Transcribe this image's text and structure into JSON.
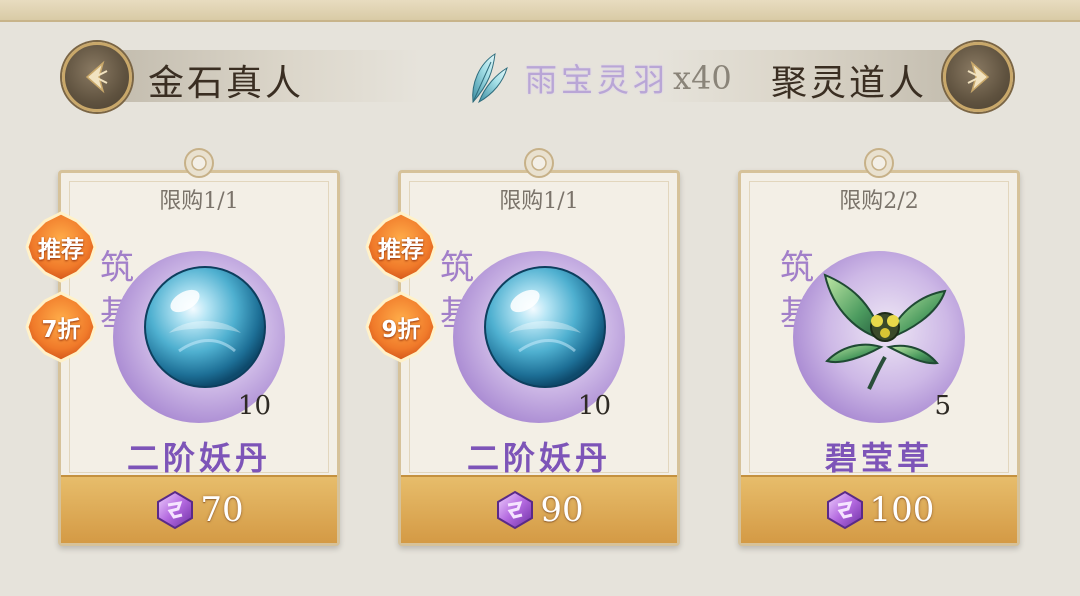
{
  "nav": {
    "left_label": "金石真人",
    "right_label": "聚灵道人",
    "currency_name": "雨宝灵羽",
    "currency_count": "x40"
  },
  "cards": [
    {
      "limit": "限购1/1",
      "grade_1": "筑",
      "grade_2": "基",
      "quantity": "10",
      "name": "二阶妖丹",
      "price": "70",
      "recommend": "推荐",
      "discount": "7折",
      "item_icon": "blue-orb-icon"
    },
    {
      "limit": "限购1/1",
      "grade_1": "筑",
      "grade_2": "基",
      "quantity": "10",
      "name": "二阶妖丹",
      "price": "90",
      "recommend": "推荐",
      "discount": "9折",
      "item_icon": "blue-orb-icon"
    },
    {
      "limit": "限购2/2",
      "grade_1": "筑",
      "grade_2": "基",
      "quantity": "5",
      "name": "碧莹草",
      "price": "100",
      "item_icon": "green-leaf-herb-icon"
    }
  ],
  "colors": {
    "name_purple": "#7d54b8",
    "grade_purple": "#a27fc9",
    "price_gold": "#d49a45",
    "badge_orange": "#f07a2a"
  }
}
